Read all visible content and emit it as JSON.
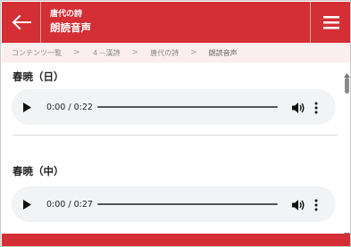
{
  "header": {
    "subtitle": "唐代の詩",
    "title": "朗読音声",
    "back_icon": "arrow-left-icon",
    "menu_icon": "hamburger-menu-icon",
    "brand_color": "#d42f35"
  },
  "breadcrumb": {
    "items": [
      "コンテンツ一覧",
      "４－漢詩",
      "唐代の詩",
      "朗読音声"
    ],
    "separator": ">"
  },
  "sections": [
    {
      "heading": "春暁（日）",
      "time": "0:00 / 0:22"
    },
    {
      "heading": "春暁（中）",
      "time": "0:00 / 0:27"
    }
  ]
}
